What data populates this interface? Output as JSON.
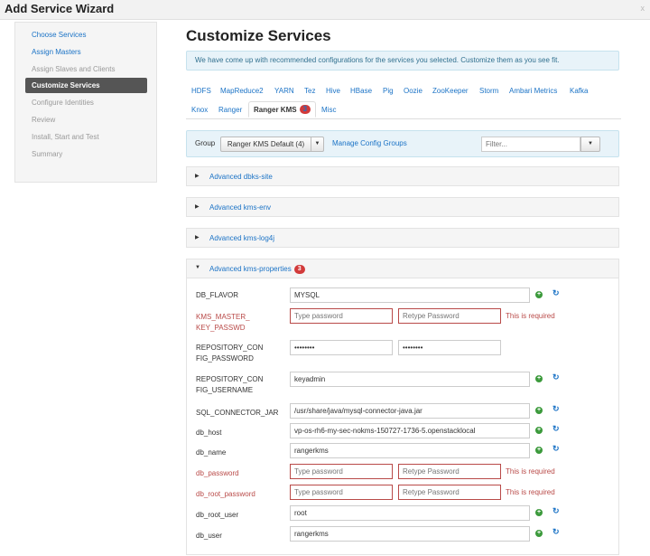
{
  "window": {
    "title": "Add Service Wizard",
    "close_glyph": "x"
  },
  "sidebar": {
    "items": [
      {
        "label": "Choose Services",
        "state": "done"
      },
      {
        "label": "Assign Masters",
        "state": "done"
      },
      {
        "label": "Assign Slaves and Clients",
        "state": "pending"
      },
      {
        "label": "Customize Services",
        "state": "active"
      },
      {
        "label": "Configure Identities",
        "state": "pending"
      },
      {
        "label": "Review",
        "state": "pending"
      },
      {
        "label": "Install, Start and Test",
        "state": "pending"
      },
      {
        "label": "Summary",
        "state": "pending"
      }
    ]
  },
  "main": {
    "title": "Customize Services",
    "info": "We have come up with recommended configurations for the services you selected. Customize them as you see fit.",
    "tabs_row1": [
      "HDFS",
      "MapReduce2",
      "YARN",
      "Tez",
      "Hive",
      "HBase",
      "Pig",
      "Oozie",
      "ZooKeeper",
      "Storm",
      "Ambari Metrics",
      "Kafka"
    ],
    "tabs_row2": [
      "Knox",
      "Ranger",
      "Ranger KMS",
      "Misc"
    ],
    "active_tab_badge": "3",
    "group": {
      "label": "Group",
      "selected": "Ranger KMS Default (4)",
      "manage_link": "Manage Config Groups",
      "filter_placeholder": "Filter..."
    },
    "sections": [
      {
        "name": "Advanced dbks-site"
      },
      {
        "name": "Advanced kms-env"
      },
      {
        "name": "Advanced kms-log4j"
      },
      {
        "name": "Advanced kms-properties",
        "badge": "3"
      }
    ],
    "properties": [
      {
        "label": "DB_FLAVOR",
        "value": "MYSQL",
        "type": "text"
      },
      {
        "label": "KMS_MASTER_KEY_PASSWD",
        "type": "password-error",
        "placeholder1": "Type password",
        "placeholder2": "Retype Password",
        "error": "This is required"
      },
      {
        "label": "REPOSITORY_CONFIG_PASSWORD",
        "type": "password",
        "value1": "••••••••",
        "value2": "••••••••"
      },
      {
        "label": "REPOSITORY_CONFIG_USERNAME",
        "value": "keyadmin",
        "type": "text"
      },
      {
        "label": "SQL_CONNECTOR_JAR",
        "value": "/usr/share/java/mysql-connector-java.jar",
        "type": "text"
      },
      {
        "label": "db_host",
        "value": "vp-os-rh6-my-sec-nokms-150727-1736-5.openstacklocal",
        "type": "text"
      },
      {
        "label": "db_name",
        "value": "rangerkms",
        "type": "text"
      },
      {
        "label": "db_password",
        "type": "password-error",
        "placeholder1": "Type password",
        "placeholder2": "Retype Password",
        "error": "This is required"
      },
      {
        "label": "db_root_password",
        "type": "password-error",
        "placeholder1": "Type password",
        "placeholder2": "Retype Password",
        "error": "This is required"
      },
      {
        "label": "db_root_user",
        "value": "root",
        "type": "text"
      },
      {
        "label": "db_user",
        "value": "rangerkms",
        "type": "text"
      }
    ],
    "icons": {
      "add": "plus-circle-icon",
      "undo": "refresh-icon"
    },
    "colors": {
      "link": "#1b73c6",
      "error": "#b94a48",
      "active_nav": "#555555",
      "info_bg": "#e8f3f9"
    }
  }
}
